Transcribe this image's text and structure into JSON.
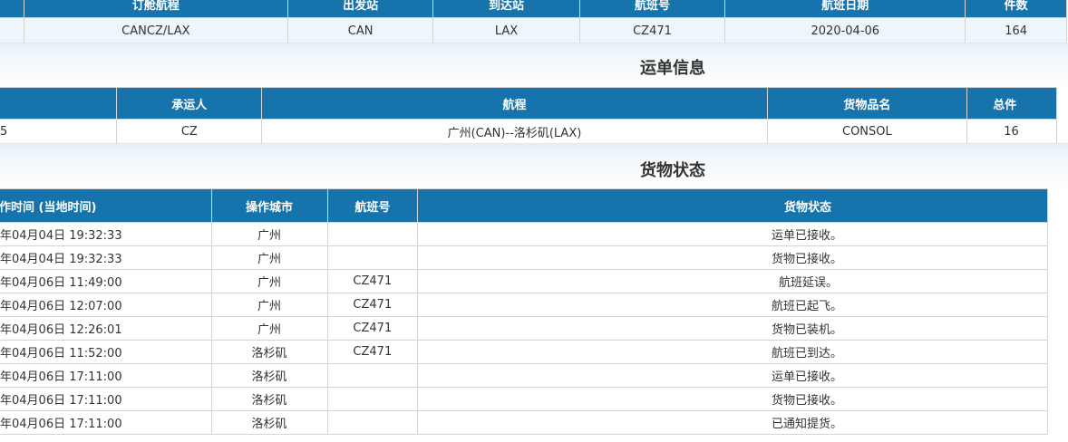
{
  "booking": {
    "headers": [
      "订舱航程",
      "出发站",
      "到达站",
      "航班号",
      "航班日期",
      "件数"
    ],
    "row": [
      "CANCZ/LAX",
      "CAN",
      "LAX",
      "CZ471",
      "2020-04-06",
      "164"
    ]
  },
  "waybill_section": {
    "title": "运单信息"
  },
  "waybill": {
    "headers": [
      "",
      "承运人",
      "航程",
      "货物品名",
      "总件"
    ],
    "row": [
      "5",
      "CZ",
      "广州(CAN)--洛杉矶(LAX)",
      "CONSOL",
      "16"
    ]
  },
  "status_section": {
    "title": "货物状态"
  },
  "status": {
    "headers": [
      "作时间 (当地时间)",
      "操作城市",
      "航班号",
      "货物状态"
    ],
    "rows": [
      {
        "time": "年04月04日 19:32:33",
        "city": "广州",
        "flight": "",
        "status": "运单已接收。"
      },
      {
        "time": "年04月04日 19:32:33",
        "city": "广州",
        "flight": "",
        "status": "货物已接收。"
      },
      {
        "time": "年04月06日 11:49:00",
        "city": "广州",
        "flight": "CZ471",
        "status": "航班延误。"
      },
      {
        "time": "年04月06日 12:07:00",
        "city": "广州",
        "flight": "CZ471",
        "status": "航班已起飞。"
      },
      {
        "time": "年04月06日 12:26:01",
        "city": "广州",
        "flight": "CZ471",
        "status": "货物已装机。"
      },
      {
        "time": "年04月06日 11:52:00",
        "city": "洛杉矶",
        "flight": "CZ471",
        "status": "航班已到达。"
      },
      {
        "time": "年04月06日 17:11:00",
        "city": "洛杉矶",
        "flight": "",
        "status": "运单已接收。"
      },
      {
        "time": "年04月06日 17:11:00",
        "city": "洛杉矶",
        "flight": "",
        "status": "货物已接收。"
      },
      {
        "time": "年04月06日 17:11:00",
        "city": "洛杉矶",
        "flight": "",
        "status": "已通知提货。"
      }
    ]
  },
  "colors": {
    "header_bg": "#1673ac",
    "header_text": "#ffffff",
    "row_alt": "#eef5fb"
  }
}
